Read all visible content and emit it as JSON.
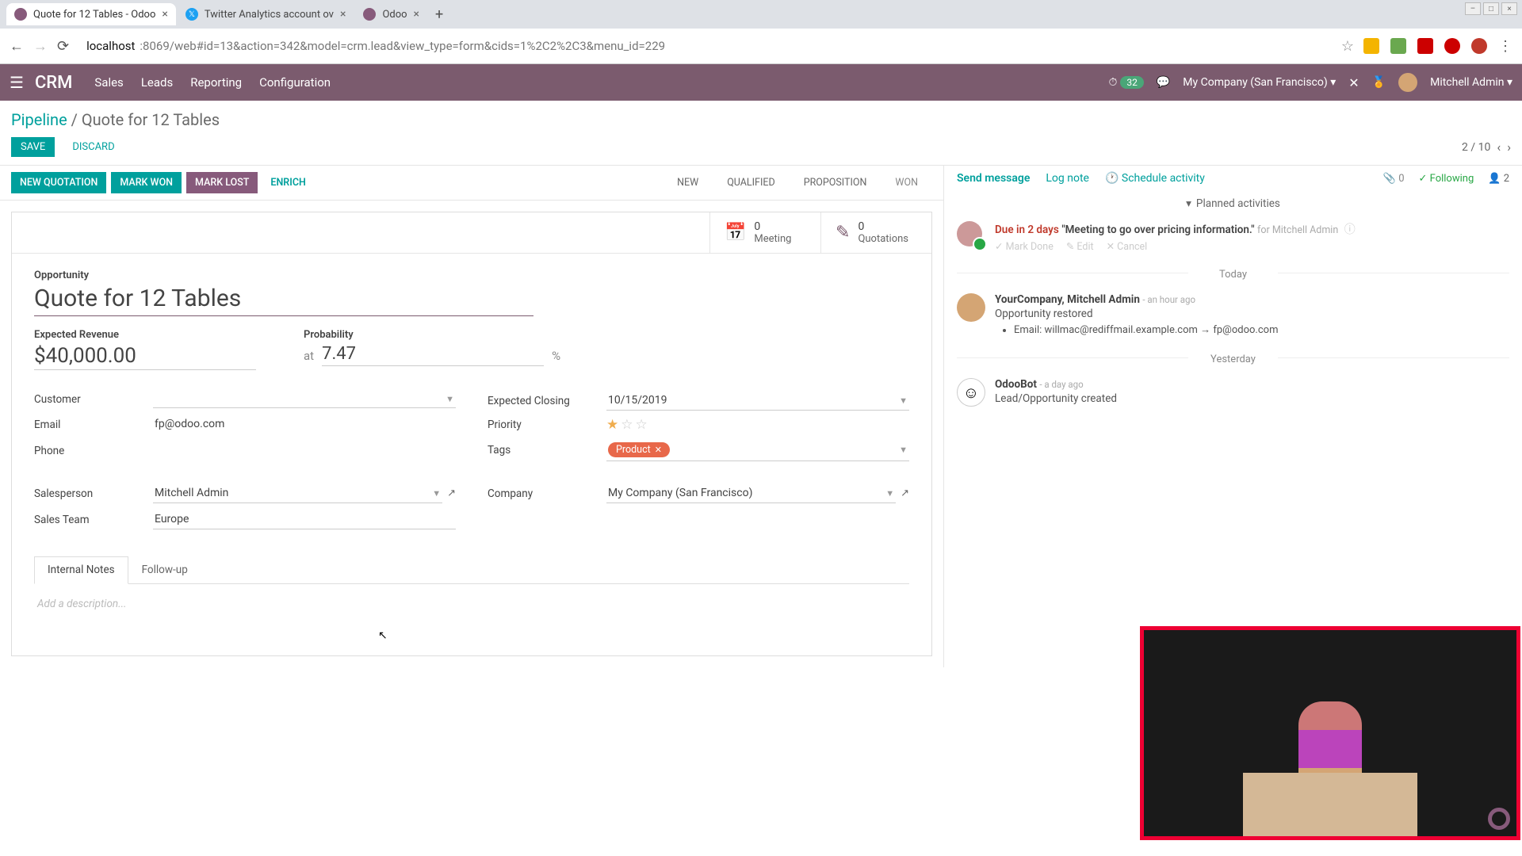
{
  "browser": {
    "tabs": [
      {
        "title": "Quote for 12 Tables - Odoo",
        "active": true,
        "favicon_bg": "#875A7B"
      },
      {
        "title": "Twitter Analytics account ov",
        "active": false,
        "favicon_bg": "#1DA1F2"
      },
      {
        "title": "Odoo",
        "active": false,
        "favicon_bg": "#875A7B"
      }
    ],
    "url_host": "localhost",
    "url_path": ":8069/web#id=13&action=342&model=crm.lead&view_type=form&cids=1%2C2%2C3&menu_id=229"
  },
  "nav": {
    "brand": "CRM",
    "menu": [
      "Sales",
      "Leads",
      "Reporting",
      "Configuration"
    ],
    "pill": "32",
    "company": "My Company (San Francisco)",
    "user": "Mitchell Admin"
  },
  "breadcrumb": {
    "root": "Pipeline",
    "current": "Quote for 12 Tables"
  },
  "buttons": {
    "save": "SAVE",
    "discard": "DISCARD"
  },
  "pager": {
    "text": "2 / 10"
  },
  "actions": {
    "new_quote": "NEW QUOTATION",
    "mark_won": "MARK WON",
    "mark_lost": "MARK LOST",
    "enrich": "ENRICH"
  },
  "stages": [
    "NEW",
    "QUALIFIED",
    "PROPOSITION",
    "WON"
  ],
  "stats": {
    "meeting": {
      "count": "0",
      "label": "Meeting"
    },
    "quotes": {
      "count": "0",
      "label": "Quotations"
    }
  },
  "form": {
    "opp_label": "Opportunity",
    "title": "Quote for 12 Tables",
    "exp_rev_label": "Expected Revenue",
    "exp_rev": "$40,000.00",
    "at": "at",
    "prob_label": "Probability",
    "prob": "7.47",
    "pct": "%",
    "customer_label": "Customer",
    "customer": "",
    "email_label": "Email",
    "email": "fp@odoo.com",
    "phone_label": "Phone",
    "phone": "",
    "closing_label": "Expected Closing",
    "closing": "10/15/2019",
    "priority_label": "Priority",
    "tags_label": "Tags",
    "tag": "Product",
    "salesperson_label": "Salesperson",
    "salesperson": "Mitchell Admin",
    "salesteam_label": "Sales Team",
    "salesteam": "Europe",
    "company_label": "Company",
    "company_val": "My Company (San Francisco)",
    "tabs": {
      "notes": "Internal Notes",
      "followup": "Follow-up"
    },
    "desc_placeholder": "Add a description..."
  },
  "chatter": {
    "send": "Send message",
    "log": "Log note",
    "schedule": "Schedule activity",
    "attach": "0",
    "following": "Following",
    "followers": "2",
    "planned_hdr": "Planned activities",
    "activity": {
      "due": "Due in 2 days",
      "title": "\"Meeting to go over pricing information.\"",
      "for": "for Mitchell Admin",
      "mark_done": "Mark Done",
      "edit": "Edit",
      "cancel": "Cancel"
    },
    "today": "Today",
    "yesterday": "Yesterday",
    "msg1": {
      "from": "YourCompany, Mitchell Admin",
      "time": "- an hour ago",
      "text": "Opportunity restored",
      "email_line": "Email: willmac@rediffmail.example.com → fp@odoo.com"
    },
    "msg2": {
      "from": "OdooBot",
      "time": "- a day ago",
      "text": "Lead/Opportunity created"
    }
  }
}
